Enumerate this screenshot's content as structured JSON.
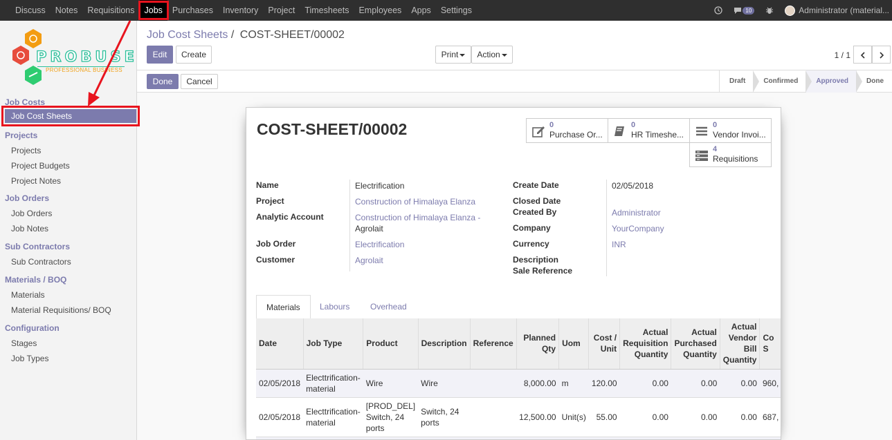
{
  "topbar": {
    "menu": [
      "Discuss",
      "Notes",
      "Requisitions",
      "Jobs",
      "Purchases",
      "Inventory",
      "Project",
      "Timesheets",
      "Employees",
      "Apps",
      "Settings"
    ],
    "active": "Jobs",
    "chat_count": "10",
    "user": "Administrator (material..."
  },
  "logo": {
    "word": "PROBUSE",
    "tagline": "PROFESSIONAL BUSINESS"
  },
  "sidebar": {
    "sections": [
      {
        "title": "Job Costs",
        "items": [
          "Job Cost Sheets"
        ]
      },
      {
        "title": "Projects",
        "items": [
          "Projects",
          "Project Budgets",
          "Project Notes"
        ]
      },
      {
        "title": "Job Orders",
        "items": [
          "Job Orders",
          "Job Notes"
        ]
      },
      {
        "title": "Sub Contractors",
        "items": [
          "Sub Contractors"
        ]
      },
      {
        "title": "Materials / BOQ",
        "items": [
          "Materials",
          "Material Requisitions/ BOQ"
        ]
      },
      {
        "title": "Configuration",
        "items": [
          "Stages",
          "Job Types"
        ]
      }
    ]
  },
  "control": {
    "breadcrumb_parent": "Job Cost Sheets",
    "breadcrumb_sep": "/",
    "breadcrumb_current": "COST-SHEET/00002",
    "edit": "Edit",
    "create": "Create",
    "print": "Print",
    "action": "Action",
    "pager": "1 / 1"
  },
  "statusbar": {
    "done": "Done",
    "cancel": "Cancel",
    "stages": [
      "Draft",
      "Confirmed",
      "Approved",
      "Done"
    ],
    "current_stage": "Approved"
  },
  "sheet": {
    "title": "COST-SHEET/00002",
    "smart_buttons": [
      {
        "count": "0",
        "label": "Purchase Or..."
      },
      {
        "count": "0",
        "label": "HR Timeshe..."
      },
      {
        "count": "0",
        "label": "Vendor Invoi..."
      },
      {
        "count": "4",
        "label": "Requisitions"
      }
    ],
    "left_fields": {
      "name_label": "Name",
      "name": "Electrification",
      "project_label": "Project",
      "project": "Construction of Himalaya Elanza",
      "analytic_label": "Analytic Account",
      "analytic_1": "Construction of Himalaya Elanza -",
      "analytic_2": "Agrolait",
      "job_order_label": "Job Order",
      "job_order": "Electrification",
      "customer_label": "Customer",
      "customer": "Agrolait"
    },
    "right_fields": {
      "create_date_label": "Create Date",
      "create_date": "02/05/2018",
      "closed_date_label": "Closed Date",
      "created_by_label": "Created By",
      "created_by": "Administrator",
      "company_label": "Company",
      "company": "YourCompany",
      "currency_label": "Currency",
      "currency": "INR",
      "description_label": "Description",
      "sale_ref_label": "Sale Reference"
    },
    "tabs": [
      "Materials",
      "Labours",
      "Overhead"
    ],
    "table": {
      "headers": [
        "Date",
        "Job Type",
        "Product",
        "Description",
        "Reference",
        "Planned Qty",
        "Uom",
        "Cost / Unit",
        "Actual Requisition Quantity",
        "Actual Purchased Quantity",
        "Actual Vendor Bill Quantity",
        "Co S"
      ],
      "rows": [
        [
          "02/05/2018",
          "Electtrification-material",
          "Wire",
          "Wire",
          "",
          "8,000.00",
          "m",
          "120.00",
          "0.00",
          "0.00",
          "0.00",
          "960,"
        ],
        [
          "02/05/2018",
          "Electtrification-material",
          "[PROD_DEL] Switch, 24 ports",
          "Switch, 24 ports",
          "",
          "12,500.00",
          "Unit(s)",
          "55.00",
          "0.00",
          "0.00",
          "0.00",
          "687,"
        ]
      ]
    }
  }
}
